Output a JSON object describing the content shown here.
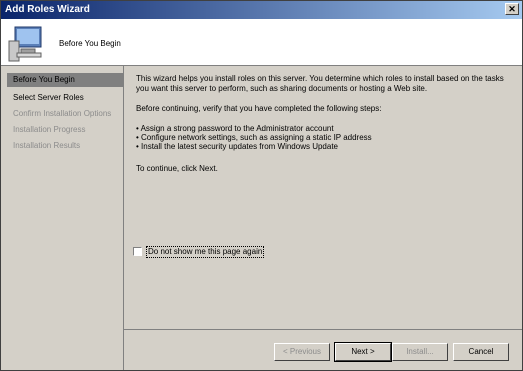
{
  "window": {
    "title": "Add Roles Wizard"
  },
  "header": {
    "title": "Before You Begin"
  },
  "sidebar": {
    "items": [
      {
        "label": "Before You Begin"
      },
      {
        "label": "Select Server Roles"
      },
      {
        "label": "Confirm Installation Options"
      },
      {
        "label": "Installation Progress"
      },
      {
        "label": "Installation Results"
      }
    ]
  },
  "content": {
    "intro": "This wizard helps you install roles on this server. You determine which roles to install based on the tasks you want this server to perform, such as sharing documents or hosting a Web site.",
    "before_continuing": "Before continuing, verify that you have completed the following steps:",
    "steps": [
      "• Assign a strong password to the Administrator account",
      "• Configure network settings, such as assigning a static IP address",
      "• Install the latest security updates from Windows Update"
    ],
    "continue_text": "To continue, click Next.",
    "checkbox_label": "Do not show me this page again",
    "checkbox_checked": false
  },
  "buttons": {
    "previous": "< Previous",
    "next": "Next >",
    "install": "Install...",
    "cancel": "Cancel"
  }
}
